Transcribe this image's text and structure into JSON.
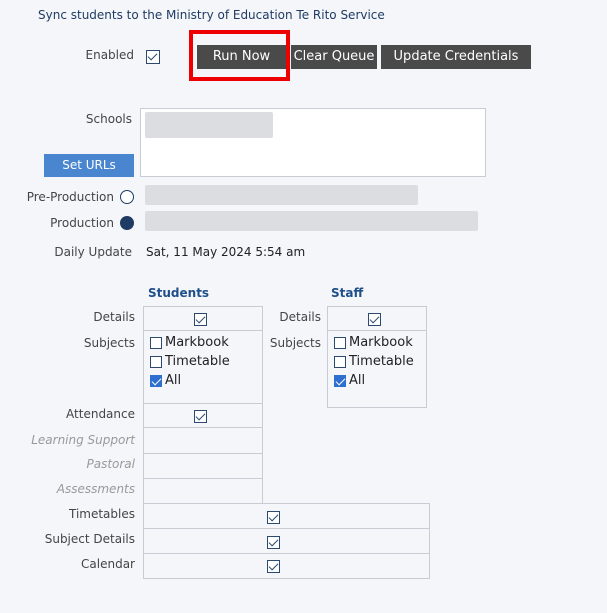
{
  "page": {
    "title": "Sync students to the Ministry of Education Te Rito Service"
  },
  "settings": {
    "enabled_label": "Enabled",
    "enabled_checked": true,
    "schools_label": "Schools",
    "set_urls_label": "Set URLs",
    "pre_production_label": "Pre-Production",
    "production_label": "Production",
    "environment_selected": "Production",
    "daily_update_label": "Daily Update",
    "daily_update_value": "Sat, 11 May 2024 5:54 am"
  },
  "toolbar": {
    "run_now_label": "Run Now",
    "clear_queue_label": "Clear Queue",
    "update_credentials_label": "Update Credentials"
  },
  "sync_options": {
    "students_header": "Students",
    "staff_header": "Staff",
    "details_label": "Details",
    "subjects_label": "Subjects",
    "markbook_label": "Markbook",
    "timetable_label": "Timetable",
    "all_label": "All",
    "students": {
      "details": true,
      "markbook": false,
      "timetable": false,
      "all": true
    },
    "staff": {
      "details": true,
      "markbook": false,
      "timetable": false,
      "all": true
    },
    "attendance_label": "Attendance",
    "attendance": true,
    "learning_support_label": "Learning Support",
    "pastoral_label": "Pastoral",
    "assessments_label": "Assessments",
    "timetables_label": "Timetables",
    "timetables": true,
    "subject_details_label": "Subject Details",
    "subject_details": true,
    "calendar_label": "Calendar",
    "calendar": true
  }
}
